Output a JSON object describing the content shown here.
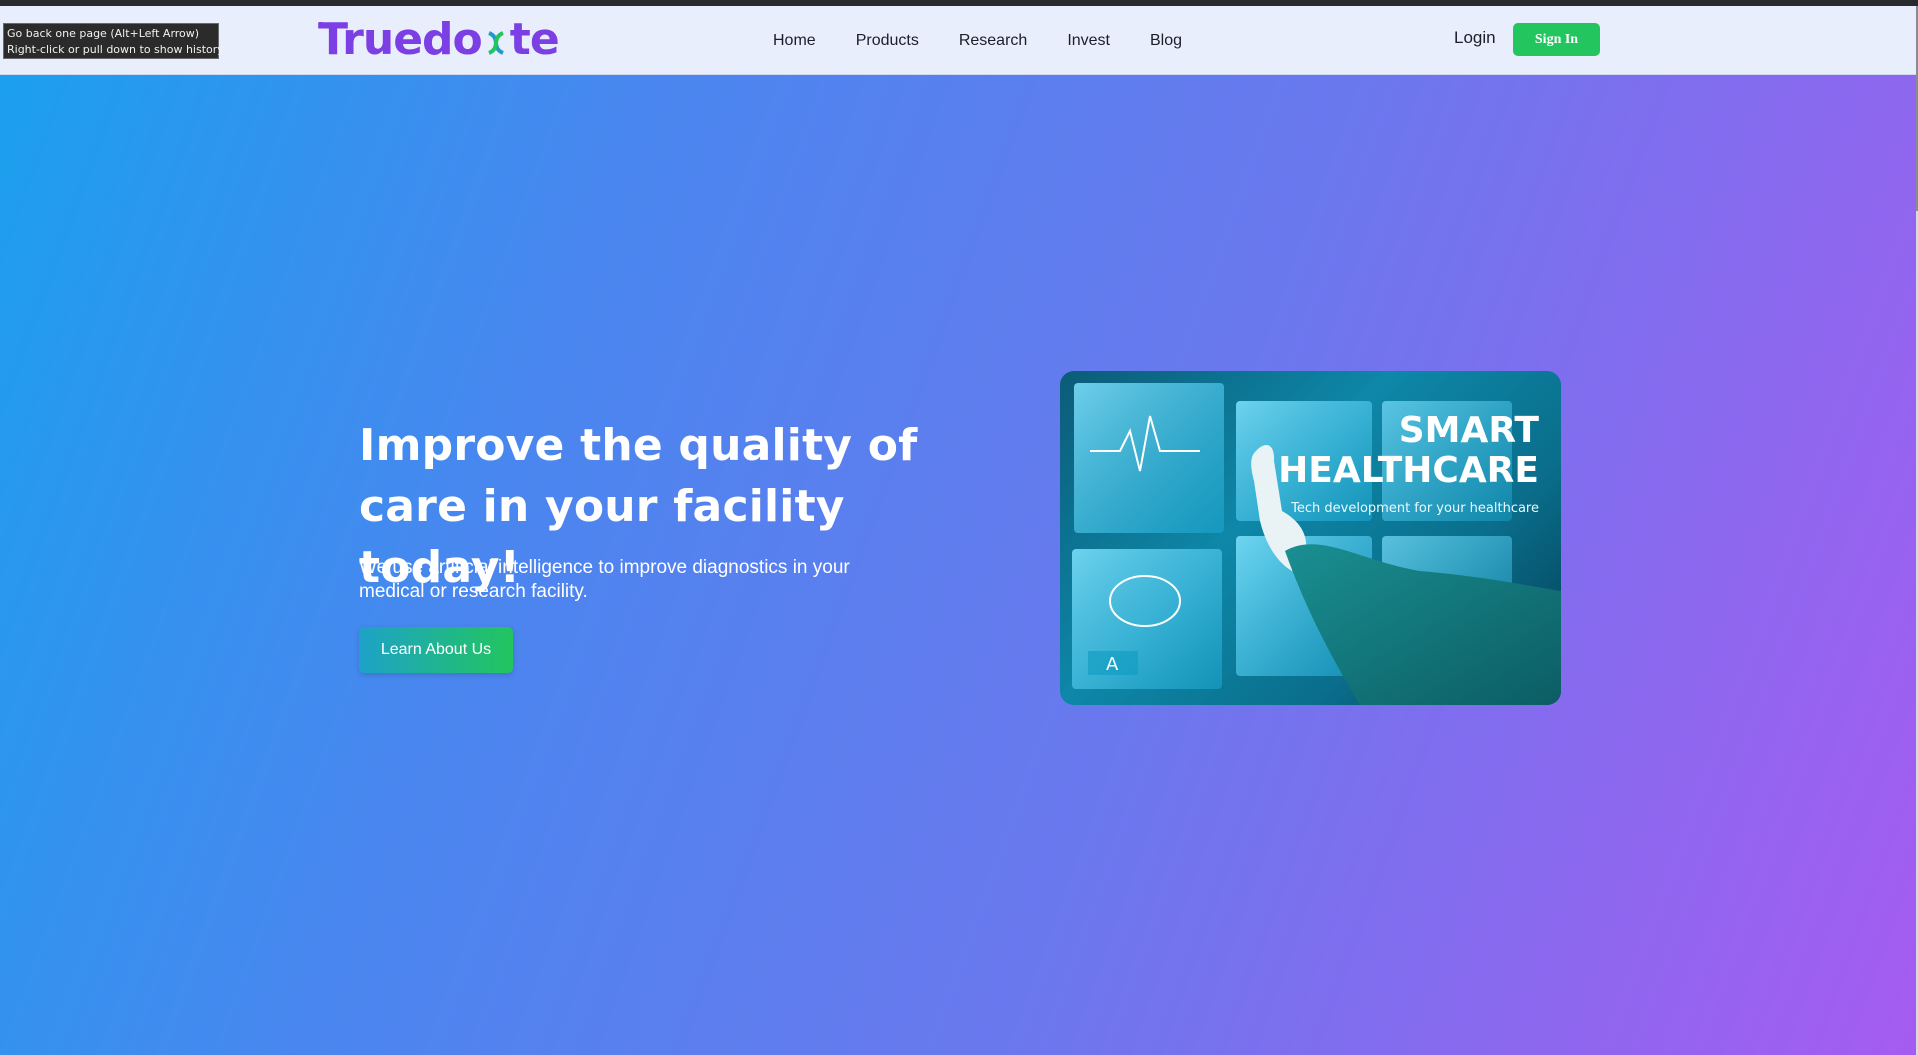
{
  "browser": {
    "tooltip_line1": "Go back one page (Alt+Left Arrow)",
    "tooltip_line2": "Right-click or pull down to show history"
  },
  "nav": {
    "logo_pre": "Truedo",
    "logo_post": "te",
    "links": [
      "Home",
      "Products",
      "Research",
      "Invest",
      "Blog"
    ],
    "login": "Login",
    "signin": "Sign In"
  },
  "hero": {
    "title": "Improve the quality of care in your facility today!",
    "subtitle": "We use artificial intelligence to improve diagnostics in your medical or research facility.",
    "cta": "Learn About Us",
    "image": {
      "title_line1": "SMART",
      "title_line2": "HEALTHCARE",
      "tagline": "Tech development for your healthcare",
      "panel_letter": "A"
    }
  },
  "colors": {
    "brand": "#7b3fe4",
    "signin": "#22c55e",
    "gradient_start": "#1aa0ee",
    "gradient_end": "#a55cf0"
  }
}
